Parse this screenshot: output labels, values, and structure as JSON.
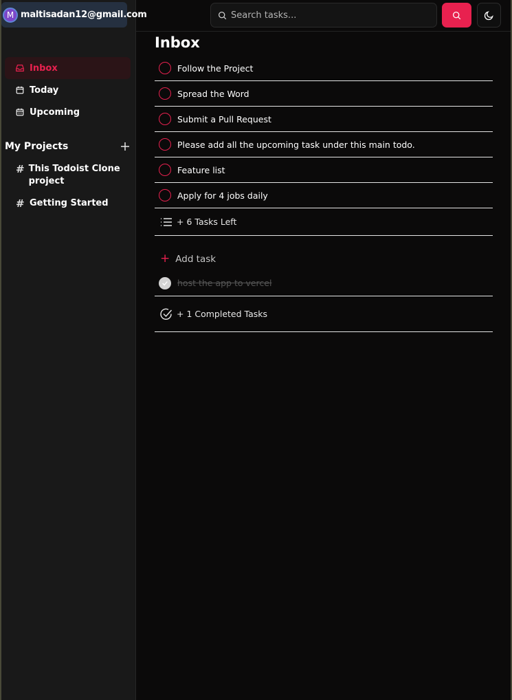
{
  "user": {
    "avatar_initial": "M",
    "email": "maltisadan12@gmail.com"
  },
  "nav": [
    {
      "label": "Inbox",
      "icon": "inbox-icon",
      "active": true
    },
    {
      "label": "Today",
      "icon": "calendar-icon",
      "active": false
    },
    {
      "label": "Upcoming",
      "icon": "calendar-grid-icon",
      "active": false
    }
  ],
  "projects": {
    "title": "My Projects",
    "add_icon": "plus-icon",
    "items": [
      {
        "label": "This Todoist Clone project",
        "icon": "hash-icon"
      },
      {
        "label": "Getting Started",
        "icon": "hash-icon"
      }
    ]
  },
  "search": {
    "placeholder": "Search tasks...",
    "button_icon": "search-icon"
  },
  "theme_toggle": {
    "icon": "moon-icon"
  },
  "page": {
    "title": "Inbox"
  },
  "tasks": [
    {
      "text": "Follow the Project"
    },
    {
      "text": "Spread the Word"
    },
    {
      "text": "Submit a Pull Request"
    },
    {
      "text": "Please add all the upcoming task under this main todo."
    },
    {
      "text": "Feature list"
    },
    {
      "text": "Apply for 4 jobs daily"
    }
  ],
  "tasks_left": "+ 6 Tasks Left",
  "add_task": {
    "plus": "+",
    "label": "Add task"
  },
  "completed": [
    {
      "text": "host the app to vercel"
    }
  ],
  "completed_summary": "+ 1 Completed Tasks",
  "colors": {
    "accent": "#e8214f",
    "background": "#0b0a0a",
    "sidebar": "#191919",
    "user_chip": "#253040"
  }
}
